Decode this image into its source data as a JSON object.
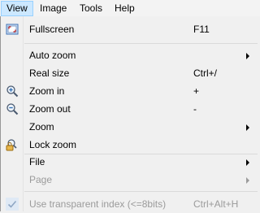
{
  "menubar": {
    "items": [
      {
        "label": "View"
      },
      {
        "label": "Image"
      },
      {
        "label": "Tools"
      },
      {
        "label": "Help"
      }
    ]
  },
  "view_menu": {
    "fullscreen": {
      "label": "Fullscreen",
      "shortcut": "F11"
    },
    "auto_zoom": {
      "label": "Auto zoom"
    },
    "real_size": {
      "label": "Real size",
      "shortcut": "Ctrl+/"
    },
    "zoom_in": {
      "label": "Zoom in",
      "shortcut": "+"
    },
    "zoom_out": {
      "label": "Zoom out",
      "shortcut": "-"
    },
    "zoom": {
      "label": "Zoom"
    },
    "lock_zoom": {
      "label": "Lock zoom"
    },
    "file": {
      "label": "File"
    },
    "page": {
      "label": "Page"
    },
    "transparent_index": {
      "label": "Use transparent index (<=8bits)",
      "shortcut": "Ctrl+Alt+H"
    }
  },
  "icons": {
    "fullscreen": "fullscreen-icon",
    "zoom_in": "zoom-in-icon",
    "zoom_out": "zoom-out-icon",
    "lock_zoom": "lock-zoom-icon",
    "checkmark": "checkmark-icon"
  },
  "colors": {
    "menu_bg": "#f0f0f0",
    "active_menu_highlight": "#cce8ff",
    "disabled_text": "#9b9b9b"
  }
}
